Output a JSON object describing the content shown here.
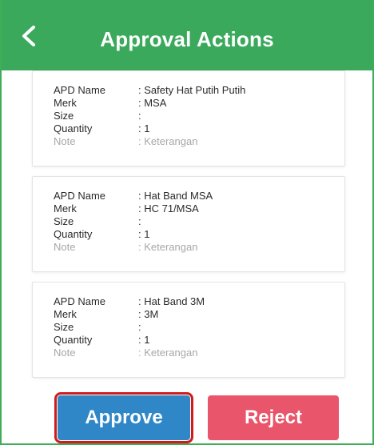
{
  "header": {
    "title": "Approval Actions",
    "back_icon": "chevron-left-icon",
    "background_color": "#3aa95b"
  },
  "labels": {
    "apd_name": "APD Name",
    "merk": "Merk",
    "size": "Size",
    "quantity": "Quantity",
    "note": "Note"
  },
  "items": [
    {
      "apd_name": ": Safety Hat Putih Putih",
      "merk": ": MSA",
      "size": ":",
      "quantity": ": 1",
      "note": ": Keterangan"
    },
    {
      "apd_name": ": Hat Band MSA",
      "merk": ": HC 71/MSA",
      "size": ":",
      "quantity": ": 1",
      "note": ": Keterangan"
    },
    {
      "apd_name": ": Hat Band 3M",
      "merk": ": 3M",
      "size": ":",
      "quantity": ": 1",
      "note": ": Keterangan"
    }
  ],
  "actions": {
    "approve_label": "Approve",
    "reject_label": "Reject",
    "approve_color": "#2f87c8",
    "reject_color": "#e9556a"
  }
}
